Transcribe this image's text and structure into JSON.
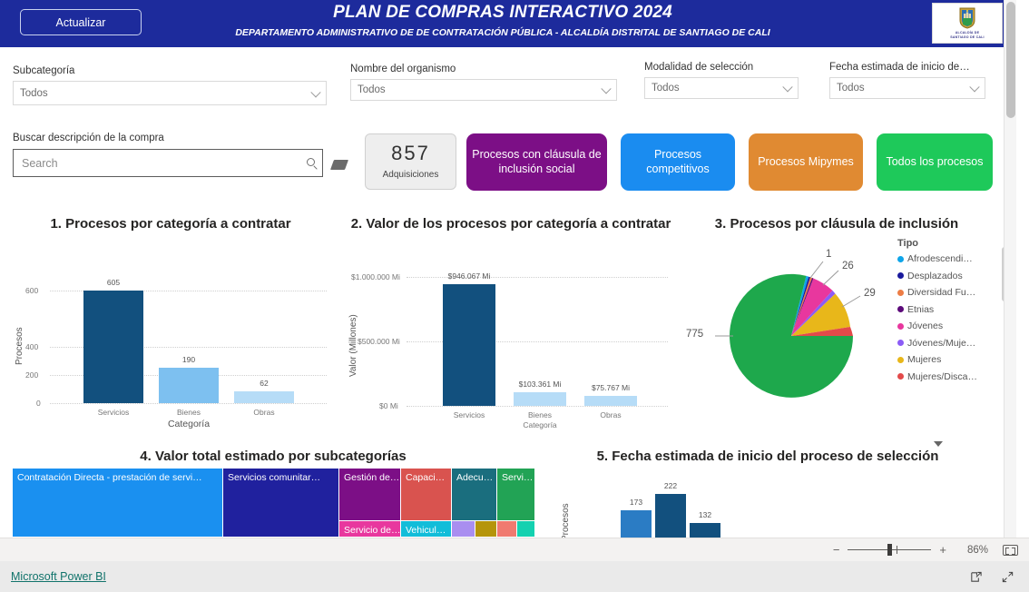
{
  "header": {
    "refresh_label": "Actualizar",
    "title": "PLAN DE COMPRAS INTERACTIVO 2024",
    "subtitle": "DEPARTAMENTO ADMINISTRATIVO DE  DE CONTRATACIÓN PÚBLICA  - ALCALDÍA DISTRITAL DE SANTIAGO DE CALI",
    "logo_caption_1": "ALCALDÍA DE",
    "logo_caption_2": "SANTIAGO DE CALI",
    "banner_color": "#1d2b9c"
  },
  "slicers": [
    {
      "label": "Subcategoría",
      "value": "Todos"
    },
    {
      "label": "Nombre del organismo",
      "value": "Todos"
    },
    {
      "label": "Modalidad de selección",
      "value": "Todos"
    },
    {
      "label": "Fecha estimada de inicio de…",
      "value": "Todos"
    }
  ],
  "search": {
    "label": "Buscar descripción de la compra",
    "placeholder": "Search",
    "value": ""
  },
  "kpi": {
    "value": "857",
    "label": "Adquisiciones"
  },
  "nav_buttons": [
    {
      "label": "Procesos con cláusula de inclusión social",
      "color": "#7c0f86"
    },
    {
      "label": "Procesos competitivos",
      "color": "#1a8cf0"
    },
    {
      "label": "Procesos Mipymes",
      "color": "#e08a32"
    },
    {
      "label": "Todos los procesos",
      "color": "#1ec95a"
    }
  ],
  "chart_data": [
    {
      "type": "bar",
      "title": "1. Procesos por categoría a contratar",
      "categories": [
        "Servicios",
        "Bienes",
        "Obras"
      ],
      "values": [
        605,
        190,
        62
      ],
      "data_labels": [
        "605",
        "190",
        "62"
      ],
      "colors": [
        "#12507e",
        "#7dc0f0",
        "#b6dcf7"
      ],
      "xlabel": "Categoría",
      "ylabel": "Procesos",
      "ylim": [
        0,
        700
      ],
      "yticks": [
        0,
        200,
        400,
        600
      ],
      "ytick_labels": [
        "0",
        "200",
        "400",
        "600"
      ],
      "grid": true,
      "legend": "none"
    },
    {
      "type": "bar",
      "title": "2. Valor de los procesos por categoría a contratar",
      "categories": [
        "Servicios",
        "Bienes",
        "Obras"
      ],
      "values": [
        946067,
        103361,
        75767
      ],
      "data_labels": [
        "$946.067 Mi",
        "$103.361 Mi",
        "$75.767 Mi"
      ],
      "colors": [
        "#12507e",
        "#b6dcf7",
        "#b6dcf7"
      ],
      "xlabel": "Categoría",
      "ylabel": "Valor (Millones)",
      "ylim": [
        0,
        1100000
      ],
      "yticks": [
        0,
        500000,
        1000000
      ],
      "ytick_labels": [
        "$0 Mi",
        "$500.000 Mi",
        "$1.000.000 Mi"
      ],
      "grid": true,
      "legend": "none"
    },
    {
      "type": "pie",
      "title": "3. Procesos por cláusula de inclusión",
      "legend_title": "Tipo",
      "legend_position": "right",
      "labels": [
        "Afrodescendi…",
        "Desplazados",
        "Diversidad Fu…",
        "Etnias",
        "Jóvenes",
        "Jóvenes/Muje…",
        "Mujeres",
        "Mujeres/Disca…"
      ],
      "colors": [
        "#0ea5e9",
        "#1a1a9c",
        "#ed7d45",
        "#5c0a7a",
        "#e8379e",
        "#8b5cf6",
        "#e8b71a",
        "#e34a4a"
      ],
      "slice_colors_visible": [
        "#0ea5e9",
        "#1a1a9c",
        "#ed7d45",
        "#5c0a7a",
        "#e8379e",
        "#8b5cf6",
        "#e8b71a",
        "#e34a4a",
        "#1ea84c"
      ],
      "callouts": [
        "1",
        "26",
        "29",
        "775"
      ],
      "callout_values": [
        1,
        26,
        29,
        775
      ],
      "major_slice_label": "775",
      "major_slice_color": "#1ea84c"
    },
    {
      "type": "treemap",
      "title": "4. Valor total estimado por subcategorías",
      "tiles": [
        {
          "label": "Contratación Directa - prestación de servi…",
          "color": "#1a90f0"
        },
        {
          "label": "Servicios comunitar…",
          "color": "#20219e"
        },
        {
          "label": "Gestión de…",
          "color": "#7c0f86"
        },
        {
          "label": "Capaci…",
          "color": "#d9534f"
        },
        {
          "label": "Adecu…",
          "color": "#1a6e7e"
        },
        {
          "label": "Servi…",
          "color": "#22a355"
        },
        {
          "label": "Servicio de…",
          "color": "#e8379e"
        },
        {
          "label": "Vehicul…",
          "color": "#12bdd9"
        },
        {
          "label": "",
          "color": "#a98ef0"
        },
        {
          "label": "",
          "color": "#b5950a"
        },
        {
          "label": "",
          "color": "#f07a70"
        },
        {
          "label": "",
          "color": "#14d1b0"
        }
      ]
    },
    {
      "type": "bar",
      "title": "5. Fecha estimada de inicio del proceso de selección",
      "categories": [
        "",
        "",
        ""
      ],
      "values": [
        173,
        222,
        132
      ],
      "data_labels": [
        "173",
        "222",
        "132"
      ],
      "colors": [
        "#2b7cc4",
        "#12507e",
        "#12507e"
      ],
      "ylabel": "Procesos",
      "ylim": [
        0,
        260
      ],
      "grid": false,
      "legend": "none"
    }
  ],
  "statusbar": {
    "zoom_out": "−",
    "zoom_in": "+",
    "zoom_level": "86%",
    "fit_icon": "fit-to-page-icon"
  },
  "footer": {
    "link": "Microsoft Power BI",
    "share_icon": "share-icon",
    "fullscreen_icon": "fullscreen-icon"
  }
}
